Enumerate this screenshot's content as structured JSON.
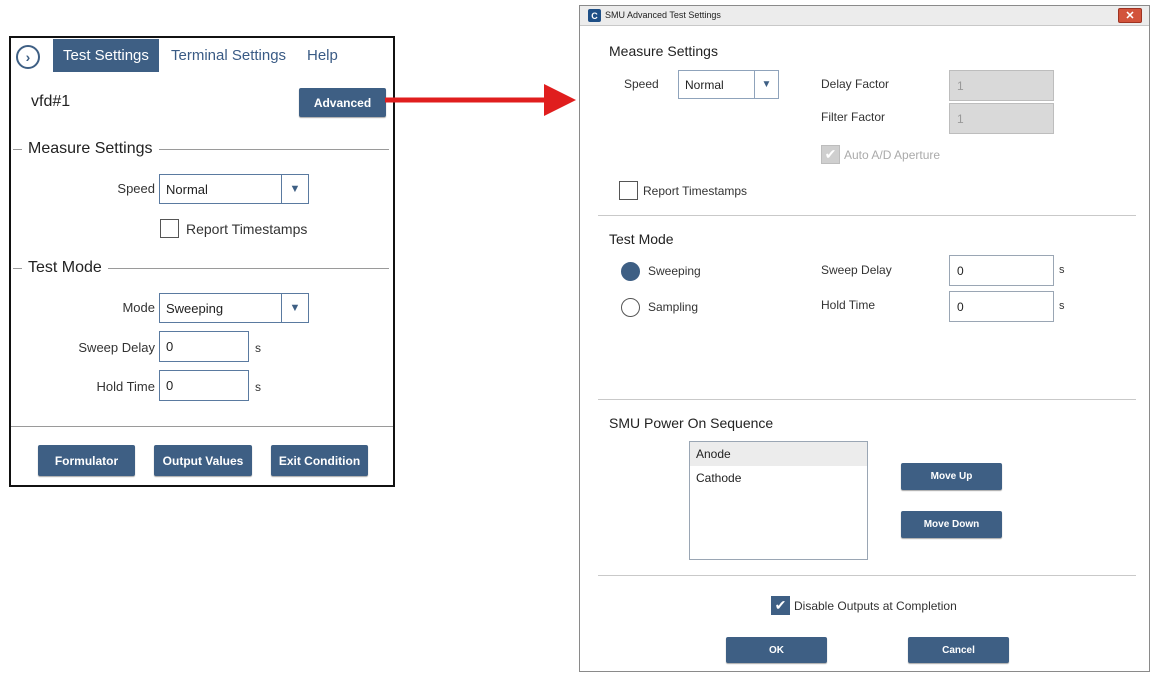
{
  "left_panel": {
    "tabs": [
      "Test Settings",
      "Terminal Settings",
      "Help"
    ],
    "device_name": "vfd#1",
    "advanced_button": "Advanced",
    "measure_settings": {
      "title": "Measure Settings",
      "speed_label": "Speed",
      "speed_value": "Normal",
      "report_timestamps_label": "Report Timestamps"
    },
    "test_mode": {
      "title": "Test Mode",
      "mode_label": "Mode",
      "mode_value": "Sweeping",
      "sweep_delay_label": "Sweep Delay",
      "sweep_delay_value": "0",
      "hold_time_label": "Hold Time",
      "hold_time_value": "0",
      "unit": "s"
    },
    "buttons": {
      "formulator": "Formulator",
      "output_values": "Output Values",
      "exit_condition": "Exit Condition"
    }
  },
  "dialog": {
    "title": "SMU Advanced Test Settings",
    "measure_settings": {
      "title": "Measure Settings",
      "speed_label": "Speed",
      "speed_value": "Normal",
      "delay_factor_label": "Delay Factor",
      "delay_factor_value": "1",
      "filter_factor_label": "Filter Factor",
      "filter_factor_value": "1",
      "auto_ad_label": "Auto A/D Aperture",
      "report_timestamps_label": "Report Timestamps"
    },
    "test_mode": {
      "title": "Test Mode",
      "sweeping_label": "Sweeping",
      "sampling_label": "Sampling",
      "selected": "Sweeping",
      "sweep_delay_label": "Sweep Delay",
      "sweep_delay_value": "0",
      "hold_time_label": "Hold Time",
      "hold_time_value": "0",
      "unit": "s"
    },
    "power_on_sequence": {
      "title": "SMU Power On Sequence",
      "items": [
        "Anode",
        "Cathode"
      ],
      "move_up": "Move Up",
      "move_down": "Move Down"
    },
    "disable_outputs_label": "Disable Outputs at Completion",
    "ok": "OK",
    "cancel": "Cancel"
  },
  "colors": {
    "accent": "#3e5f84",
    "arrow": "#e01e1e"
  }
}
